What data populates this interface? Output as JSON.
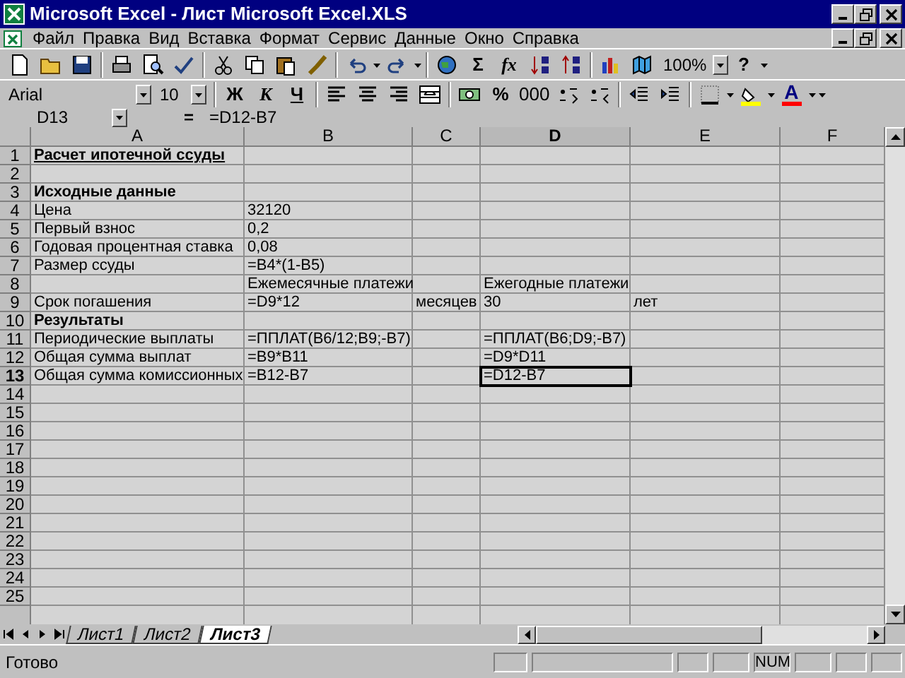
{
  "window": {
    "title": "Microsoft Excel - Лист Microsoft Excel.XLS"
  },
  "menu": [
    "Файл",
    "Правка",
    "Вид",
    "Вставка",
    "Формат",
    "Сервис",
    "Данные",
    "Окно",
    "Справка"
  ],
  "standard_toolbar": {
    "sum": "Σ",
    "function": "fx",
    "zoom": "100%",
    "help": "?"
  },
  "formatting_toolbar": {
    "font": "Arial",
    "size": "10",
    "bold": "Ж",
    "italic": "К",
    "underline": "Ч",
    "percent": "%",
    "thousands": "000",
    "font_color": "A"
  },
  "formula_bar": {
    "name_box": "D13",
    "equals": "=",
    "formula": "=D12-B7"
  },
  "columns": [
    {
      "label": "A",
      "selected": false
    },
    {
      "label": "B",
      "selected": false
    },
    {
      "label": "C",
      "selected": false
    },
    {
      "label": "D",
      "selected": true
    },
    {
      "label": "E",
      "selected": false
    },
    {
      "label": "F",
      "selected": false
    }
  ],
  "rows": [
    {
      "number": "1",
      "selected": false,
      "cells": [
        {
          "text": "Расчет ипотечной ссуды",
          "bold": true,
          "underline": true,
          "selected": false
        },
        {
          "selected": false
        },
        {
          "selected": false
        },
        {
          "selected": false
        },
        {
          "selected": false
        },
        {
          "selected": false
        }
      ]
    },
    {
      "number": "2",
      "selected": false,
      "cells": [
        {
          "selected": false
        },
        {
          "selected": false
        },
        {
          "selected": false
        },
        {
          "selected": false
        },
        {
          "selected": false
        },
        {
          "selected": false
        }
      ]
    },
    {
      "number": "3",
      "selected": false,
      "cells": [
        {
          "text": "Исходные данные",
          "bold": true,
          "underline": false,
          "selected": false
        },
        {
          "selected": false
        },
        {
          "selected": false
        },
        {
          "selected": false
        },
        {
          "selected": false
        },
        {
          "selected": false
        }
      ]
    },
    {
      "number": "4",
      "selected": false,
      "cells": [
        {
          "text": "Цена",
          "bold": false,
          "underline": false,
          "selected": false
        },
        {
          "text": "32120",
          "bold": false,
          "underline": false,
          "selected": false
        },
        {
          "selected": false
        },
        {
          "selected": false
        },
        {
          "selected": false
        },
        {
          "selected": false
        }
      ]
    },
    {
      "number": "5",
      "selected": false,
      "cells": [
        {
          "text": "Первый взнос",
          "bold": false,
          "underline": false,
          "selected": false
        },
        {
          "text": "0,2",
          "bold": false,
          "underline": false,
          "selected": false
        },
        {
          "selected": false
        },
        {
          "selected": false
        },
        {
          "selected": false
        },
        {
          "selected": false
        }
      ]
    },
    {
      "number": "6",
      "selected": false,
      "cells": [
        {
          "text": "Годовая процентная ставка",
          "bold": false,
          "underline": false,
          "selected": false
        },
        {
          "text": "0,08",
          "bold": false,
          "underline": false,
          "selected": false
        },
        {
          "selected": false
        },
        {
          "selected": false
        },
        {
          "selected": false
        },
        {
          "selected": false
        }
      ]
    },
    {
      "number": "7",
      "selected": false,
      "cells": [
        {
          "text": "Размер ссуды",
          "bold": false,
          "underline": false,
          "selected": false
        },
        {
          "text": "=B4*(1-B5)",
          "bold": false,
          "underline": false,
          "selected": false
        },
        {
          "selected": false
        },
        {
          "selected": false
        },
        {
          "selected": false
        },
        {
          "selected": false
        }
      ]
    },
    {
      "number": "8",
      "selected": false,
      "cells": [
        {
          "selected": false
        },
        {
          "text": "Ежемесячные платежи",
          "bold": false,
          "underline": false,
          "selected": false
        },
        {
          "selected": false
        },
        {
          "text": "Ежегодные платежи",
          "bold": false,
          "underline": false,
          "selected": false
        },
        {
          "selected": false
        },
        {
          "selected": false
        }
      ]
    },
    {
      "number": "9",
      "selected": false,
      "cells": [
        {
          "text": "Срок погашения",
          "bold": false,
          "underline": false,
          "selected": false
        },
        {
          "text": "=D9*12",
          "bold": false,
          "underline": false,
          "selected": false
        },
        {
          "text": "месяцев",
          "bold": false,
          "underline": false,
          "selected": false
        },
        {
          "text": "30",
          "bold": false,
          "underline": false,
          "selected": false
        },
        {
          "text": "лет",
          "bold": false,
          "underline": false,
          "selected": false
        },
        {
          "selected": false
        }
      ]
    },
    {
      "number": "10",
      "selected": false,
      "cells": [
        {
          "text": "Результаты",
          "bold": true,
          "underline": false,
          "selected": false
        },
        {
          "selected": false
        },
        {
          "selected": false
        },
        {
          "selected": false
        },
        {
          "selected": false
        },
        {
          "selected": false
        }
      ]
    },
    {
      "number": "11",
      "selected": false,
      "cells": [
        {
          "text": "Периодические выплаты",
          "bold": false,
          "underline": false,
          "selected": false
        },
        {
          "text": "=ППЛАТ(B6/12;B9;-B7)",
          "bold": false,
          "underline": false,
          "selected": false
        },
        {
          "selected": false
        },
        {
          "text": "=ППЛАТ(B6;D9;-B7)",
          "bold": false,
          "underline": false,
          "selected": false
        },
        {
          "selected": false
        },
        {
          "selected": false
        }
      ]
    },
    {
      "number": "12",
      "selected": false,
      "cells": [
        {
          "text": "Общая сумма выплат",
          "bold": false,
          "underline": false,
          "selected": false
        },
        {
          "text": "=B9*B11",
          "bold": false,
          "underline": false,
          "selected": false
        },
        {
          "selected": false
        },
        {
          "text": "=D9*D11",
          "bold": false,
          "underline": false,
          "selected": false
        },
        {
          "selected": false
        },
        {
          "selected": false
        }
      ]
    },
    {
      "number": "13",
      "selected": true,
      "cells": [
        {
          "text": "Общая сумма комиссионных",
          "bold": false,
          "underline": false,
          "selected": false
        },
        {
          "text": "=B12-B7",
          "bold": false,
          "underline": false,
          "selected": false
        },
        {
          "selected": false
        },
        {
          "text": "=D12-B7",
          "bold": false,
          "underline": false,
          "selected": true
        },
        {
          "selected": false
        },
        {
          "selected": false
        }
      ]
    },
    {
      "number": "14",
      "selected": false
    },
    {
      "number": "15",
      "selected": false
    },
    {
      "number": "16",
      "selected": false
    },
    {
      "number": "17",
      "selected": false
    },
    {
      "number": "18",
      "selected": false
    },
    {
      "number": "19",
      "selected": false
    },
    {
      "number": "20",
      "selected": false
    },
    {
      "number": "21",
      "selected": false
    },
    {
      "number": "22",
      "selected": false
    },
    {
      "number": "23",
      "selected": false
    },
    {
      "number": "24",
      "selected": false
    },
    {
      "number": "25",
      "selected": false
    }
  ],
  "sheet_tabs": [
    {
      "label": "Лист1",
      "selected": false
    },
    {
      "label": "Лист2",
      "selected": false
    },
    {
      "label": "Лист3",
      "selected": true
    }
  ],
  "status_bar": {
    "message": "Готово",
    "indicator": "NUM"
  }
}
